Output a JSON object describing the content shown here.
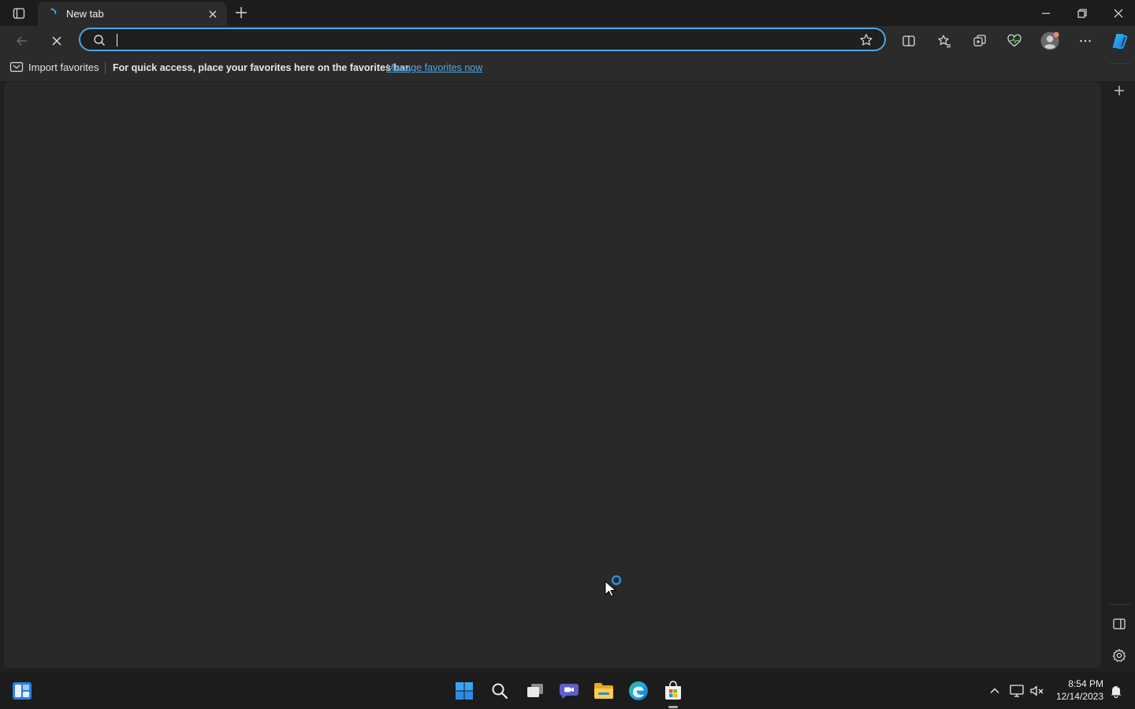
{
  "browser": {
    "tab": {
      "title": "New tab"
    },
    "omnibox": {
      "value": "",
      "placeholder": ""
    },
    "favorites_bar": {
      "import_label": "Import favorites",
      "message": "For quick access, place your favorites here on the favorites bar.",
      "manage_link": "Manage favorites now"
    },
    "toolbar_icons": [
      "split-screen-icon",
      "favorites-icon",
      "collections-icon",
      "browser-essentials-icon",
      "profile-icon",
      "more-icon",
      "copilot-icon"
    ],
    "window_controls": [
      "minimize-icon",
      "restore-icon",
      "close-icon"
    ],
    "sidebar_icons": [
      "add-icon",
      "hide-sidebar-icon",
      "settings-icon"
    ]
  },
  "taskbar": {
    "apps": [
      "widgets",
      "start",
      "search",
      "task-view",
      "chat",
      "file-explorer",
      "edge",
      "store"
    ],
    "tray_icons": [
      "show-hidden-icons",
      "network-icon",
      "volume-icon",
      "notifications-icon"
    ],
    "time": "8:54 PM",
    "date": "12/14/2023"
  },
  "colors": {
    "accent": "#4aa8e8",
    "background": "#202020",
    "content": "#292929",
    "toolbar": "#2b2b2b"
  }
}
